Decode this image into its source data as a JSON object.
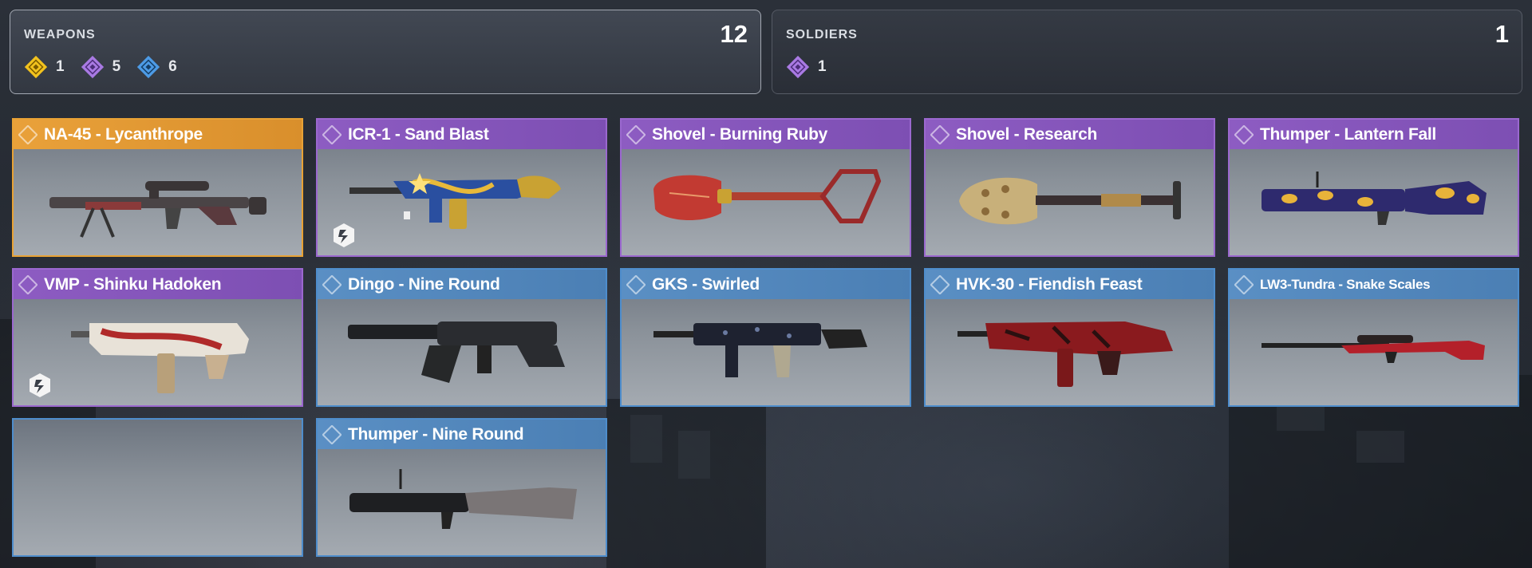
{
  "summary": {
    "weapons": {
      "label": "WEAPONS",
      "count": "12",
      "rarities": [
        {
          "tier": "legendary",
          "icon": "gold-gem-icon",
          "color": "#f2c21e",
          "count": "1"
        },
        {
          "tier": "epic",
          "icon": "purple-gem-icon",
          "color": "#a97ae3",
          "count": "5"
        },
        {
          "tier": "rare",
          "icon": "blue-gem-icon",
          "color": "#4d9be6",
          "count": "6"
        }
      ]
    },
    "soldiers": {
      "label": "SOLDIERS",
      "count": "1",
      "rarities": [
        {
          "tier": "epic",
          "icon": "purple-gem-icon",
          "color": "#a97ae3",
          "count": "1"
        }
      ]
    }
  },
  "colors": {
    "legendary": "#e8a235",
    "epic": "#9b68cf",
    "rare": "#4e8dcc"
  },
  "cards": [
    {
      "name": "NA-45 - Lycanthrope",
      "rarity": "legendary",
      "art": "sniper-rifle-icon",
      "badge": false
    },
    {
      "name": "ICR-1 - Sand Blast",
      "rarity": "epic",
      "art": "assault-rifle-icon",
      "badge": true
    },
    {
      "name": "Shovel - Burning Ruby",
      "rarity": "epic",
      "art": "shovel-icon",
      "badge": false
    },
    {
      "name": "Shovel - Research",
      "rarity": "epic",
      "art": "shovel-icon",
      "badge": false
    },
    {
      "name": "Thumper - Lantern Fall",
      "rarity": "epic",
      "art": "grenade-launcher-icon",
      "badge": false
    },
    {
      "name": "VMP - Shinku Hadoken",
      "rarity": "epic",
      "art": "smg-icon",
      "badge": true
    },
    {
      "name": "Dingo - Nine Round",
      "rarity": "rare",
      "art": "lmg-icon",
      "badge": false
    },
    {
      "name": "GKS - Swirled",
      "rarity": "rare",
      "art": "smg-icon",
      "badge": false
    },
    {
      "name": "HVK-30 - Fiendish Feast",
      "rarity": "rare",
      "art": "assault-rifle-icon",
      "badge": false
    },
    {
      "name": "LW3-Tundra - Snake Scales",
      "rarity": "rare",
      "art": "sniper-rifle-icon",
      "badge": false
    },
    {
      "name": "",
      "rarity": "empty",
      "art": "",
      "badge": false
    },
    {
      "name": "Thumper - Nine Round",
      "rarity": "rare",
      "art": "grenade-launcher-icon",
      "badge": false
    }
  ]
}
